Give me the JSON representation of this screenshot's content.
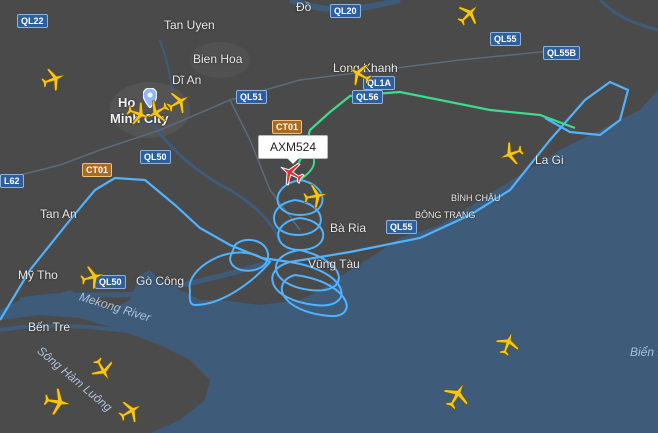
{
  "flight": {
    "callsign": "AXM524"
  },
  "places": {
    "tan_uyen": "Tan Uyen",
    "bien_hoa": "Bien Hoa",
    "di_an": "Dĩ An",
    "hcmc_1": "Ho",
    "hcmc_2": "Minh City",
    "long_khanh": "Long Khanh",
    "ba_ria": "Bà Ria",
    "vung_tau": "Vũng Tàu",
    "tan_an": "Tan An",
    "my_tho": "Mỹ Tho",
    "go_cong": "Gò Công",
    "ben_tre": "Bến Tre",
    "la_gi": "La Gi",
    "binh_chau": "BÌNH CHÂU",
    "bong_trang": "BÔNG TRANG",
    "dong": "Đồ",
    "bien_edge": "Biển Đ"
  },
  "water": {
    "mekong": "Mekong River",
    "song_ham_luong": "Sông Hàm Luông"
  },
  "roads": {
    "ql22": "QL22",
    "ql20": "QL20",
    "ql55": "QL55",
    "ql55b": "QL55B",
    "ql51": "QL51",
    "ql1a": "QL1A",
    "ql56": "QL56",
    "ct01_a": "CT01",
    "ct01_b": "CT01",
    "ql50_a": "QL50",
    "ql50_b": "QL50",
    "l62": "L62",
    "ql55_s": "QL55"
  },
  "colors": {
    "land": "#4a4a4a",
    "sea": "#3e5b7a",
    "track_blue": "#4fb3ff",
    "track_green": "#3cdc8c",
    "plane": "#f5c518",
    "selected_plane": "#e03030"
  },
  "icons": {
    "aircraft": "airplane-icon",
    "location": "location-pin-icon"
  }
}
